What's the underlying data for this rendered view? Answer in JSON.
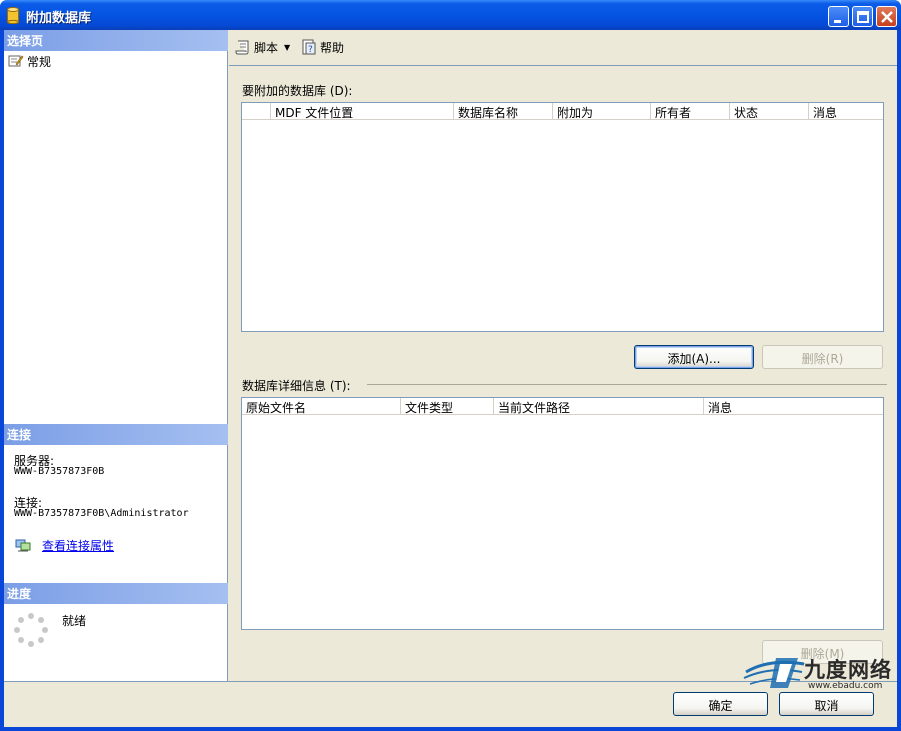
{
  "window": {
    "title": "附加数据库"
  },
  "left": {
    "select_page_header": "选择页",
    "pages": [
      {
        "label": "常规"
      }
    ],
    "connection_header": "连接",
    "server_label": "服务器:",
    "server_value": "WWW-B7357873F0B",
    "connection_label": "连接:",
    "connection_value": "WWW-B7357873F0B\\Administrator",
    "view_connection_link": "查看连接属性",
    "progress_header": "进度",
    "progress_status": "就绪"
  },
  "toolbar": {
    "script_label": "脚本",
    "help_label": "帮助"
  },
  "attach": {
    "label": "要附加的数据库 (D):",
    "columns": [
      "MDF 文件位置",
      "数据库名称",
      "附加为",
      "所有者",
      "状态",
      "消息"
    ],
    "rows": []
  },
  "buttons": {
    "add": "添加(A)...",
    "remove_top": "删除(R)",
    "remove_bottom": "删除(M)",
    "ok": "确定",
    "cancel": "取消"
  },
  "details": {
    "label": "数据库详细信息 (T):",
    "columns": [
      "原始文件名",
      "文件类型",
      "当前文件路径",
      "消息"
    ],
    "rows": []
  },
  "watermark": {
    "brand": "九度网络",
    "url": "www.ebadu.com"
  },
  "colors": {
    "title_bar": "#0554e2",
    "section_header": "#7b9ee6",
    "dialog_bg": "#ece9d8",
    "link": "#0000ee"
  }
}
